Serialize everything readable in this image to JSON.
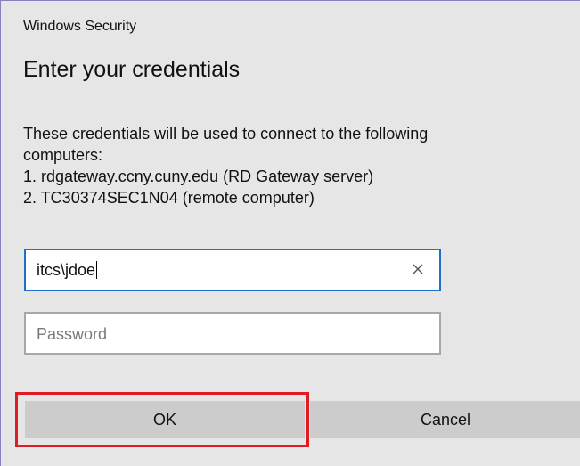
{
  "window": {
    "title": "Windows Security"
  },
  "dialog": {
    "heading": "Enter your credentials",
    "message_lines": [
      "These credentials will be used to connect to the following",
      "computers:",
      "1. rdgateway.ccny.cuny.edu (RD Gateway server)",
      "2. TC30374SEC1N04 (remote computer)"
    ]
  },
  "form": {
    "username": {
      "value": "itcs\\jdoe",
      "clear_icon": "close-icon"
    },
    "password": {
      "value": "",
      "placeholder": "Password"
    }
  },
  "buttons": {
    "ok_label": "OK",
    "cancel_label": "Cancel"
  },
  "colors": {
    "dialog_background": "#e6e6e6",
    "focus_border": "#1f70c9",
    "button_background": "#cccccc",
    "highlight": "#e11b22"
  }
}
